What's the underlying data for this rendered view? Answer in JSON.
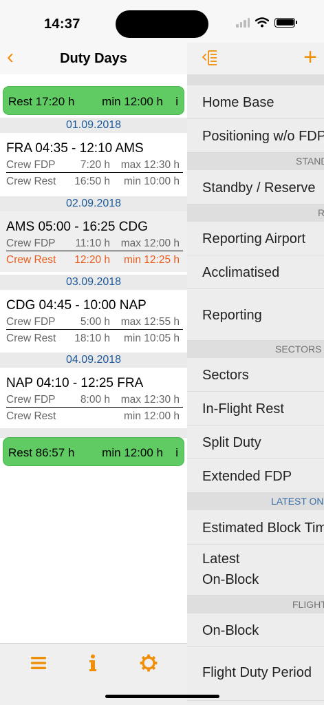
{
  "status_bar": {
    "time": "14:37"
  },
  "left_nav": {
    "back_glyph": "‹",
    "title": "Duty Days"
  },
  "rest_banners": [
    {
      "left": "Rest 17:20 h",
      "min": "min 12:00 h",
      "info": "i"
    },
    {
      "left": "Rest 86:57 h",
      "min": "min 12:00 h",
      "info": "i"
    }
  ],
  "duty_days": [
    {
      "date": "01.09.2018",
      "route": "FRA 04:35 - 12:10 AMS",
      "fdp": {
        "label": "Crew FDP",
        "value": "7:20 h",
        "limit": "max 12:30 h"
      },
      "rest": {
        "label": "Crew Rest",
        "value": "16:50 h",
        "limit": "min 10:00 h"
      }
    },
    {
      "date": "02.09.2018",
      "route": "AMS 05:00 - 16:25 CDG",
      "fdp": {
        "label": "Crew FDP",
        "value": "11:10 h",
        "limit": "max 12:00 h"
      },
      "rest": {
        "label": "Crew Rest",
        "value": "12:20 h",
        "limit": "min 12:25 h"
      }
    },
    {
      "date": "03.09.2018",
      "route": "CDG 04:45 - 10:00 NAP",
      "fdp": {
        "label": "Crew FDP",
        "value": "5:00 h",
        "limit": "max 12:55 h"
      },
      "rest": {
        "label": "Crew Rest",
        "value": "18:10 h",
        "limit": "min 10:05 h"
      }
    },
    {
      "date": "04.09.2018",
      "route": "NAP 04:10 - 12:25 FRA",
      "fdp": {
        "label": "Crew FDP",
        "value": "8:00 h",
        "limit": "max 12:30 h"
      },
      "rest": {
        "label": "Crew Rest",
        "value": "",
        "limit": "min 12:00 h"
      }
    }
  ],
  "tab_bar": {
    "icons": [
      "list-icon",
      "info-icon",
      "gear-icon"
    ]
  },
  "right_nav": {
    "add_glyph": "+"
  },
  "right_panel": {
    "home_base": "Home Base",
    "positioning": "Positioning w/o FDP",
    "sep_standby": "STANDBY",
    "standby_reserve": "Standby / Reserve",
    "sep_reporting": "R",
    "reporting_airport": "Reporting Airport",
    "acclimatised": "Acclimatised",
    "reporting": "Reporting",
    "sep_sectors": "SECTORS",
    "sectors": "Sectors",
    "in_flight_rest": "In-Flight Rest",
    "split_duty": "Split Duty",
    "extended_fdp": "Extended FDP",
    "sep_latest": "LATEST ON",
    "estimated_block": "Estimated Block Time",
    "latest_line1": "Latest",
    "latest_line2": "On-Block",
    "sep_flight": "FLIGHT",
    "on_block": "On-Block",
    "flight_duty_period": "Flight Duty Period"
  },
  "colors": {
    "accent": "#f0900a",
    "rest_green": "#5fcb62",
    "date_blue": "#1d5a9a",
    "warning_orange": "#ea5a1c"
  }
}
